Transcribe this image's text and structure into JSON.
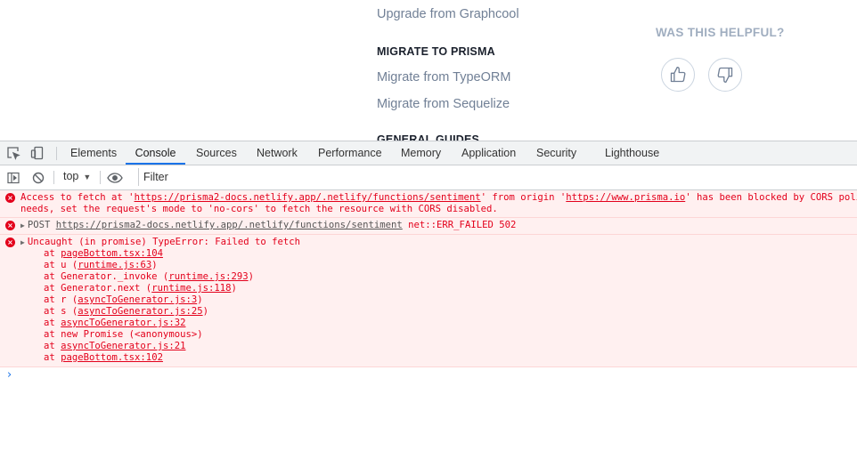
{
  "site": {
    "links": {
      "upgrade_graphcool": "Upgrade from Graphcool",
      "migrate_typeorm": "Migrate from TypeORM",
      "migrate_sequelize": "Migrate from Sequelize"
    },
    "headings": {
      "migrate_to_prisma": "MIGRATE TO PRISMA",
      "general_guides": "GENERAL GUIDES"
    },
    "feedback": {
      "label": "WAS THIS HELPFUL?",
      "icons": [
        "thumbs-up-icon",
        "thumbs-down-icon"
      ]
    }
  },
  "devtools": {
    "tabs": [
      "Elements",
      "Console",
      "Sources",
      "Network",
      "Performance",
      "Memory",
      "Application",
      "Security",
      "Lighthouse"
    ],
    "active_tab": "Console",
    "toolbar": {
      "context": "top",
      "filter_placeholder": "Filter"
    },
    "colors": {
      "error": "#e3001b",
      "error_bg": "#fff0f0",
      "active_tab": "#1a73e8"
    },
    "messages": {
      "cors": {
        "p1": "Access to fetch at '",
        "url1": "https://prisma2-docs.netlify.app/.netlify/functions/sentiment",
        "p2": "' from origin '",
        "url2": "https://www.prisma.io",
        "p3": "' has been blocked by CORS policy",
        "line2": "needs, set the request's mode to 'no-cors' to fetch the resource with CORS disabled."
      },
      "post": {
        "method": "POST ",
        "url": "https://prisma2-docs.netlify.app/.netlify/functions/sentiment",
        "status": " net::ERR_FAILED 502"
      },
      "uncaught": {
        "title": "Uncaught (in promise) TypeError: Failed to fetch",
        "frames": [
          {
            "pre": "at ",
            "fn": "",
            "link": "pageBottom.tsx:104",
            "post": ""
          },
          {
            "pre": "at u (",
            "fn": "",
            "link": "runtime.js:63",
            "post": ")"
          },
          {
            "pre": "at Generator._invoke (",
            "fn": "",
            "link": "runtime.js:293",
            "post": ")"
          },
          {
            "pre": "at Generator.next (",
            "fn": "",
            "link": "runtime.js:118",
            "post": ")"
          },
          {
            "pre": "at r (",
            "fn": "",
            "link": "asyncToGenerator.js:3",
            "post": ")"
          },
          {
            "pre": "at s (",
            "fn": "",
            "link": "asyncToGenerator.js:25",
            "post": ")"
          },
          {
            "pre": "at ",
            "fn": "",
            "link": "asyncToGenerator.js:32",
            "post": ""
          },
          {
            "pre": "at new Promise (<anonymous>)",
            "fn": "",
            "link": "",
            "post": ""
          },
          {
            "pre": "at ",
            "fn": "",
            "link": "asyncToGenerator.js:21",
            "post": ""
          },
          {
            "pre": "at ",
            "fn": "",
            "link": "pageBottom.tsx:102",
            "post": ""
          }
        ]
      }
    },
    "prompt_symbol": "›"
  }
}
